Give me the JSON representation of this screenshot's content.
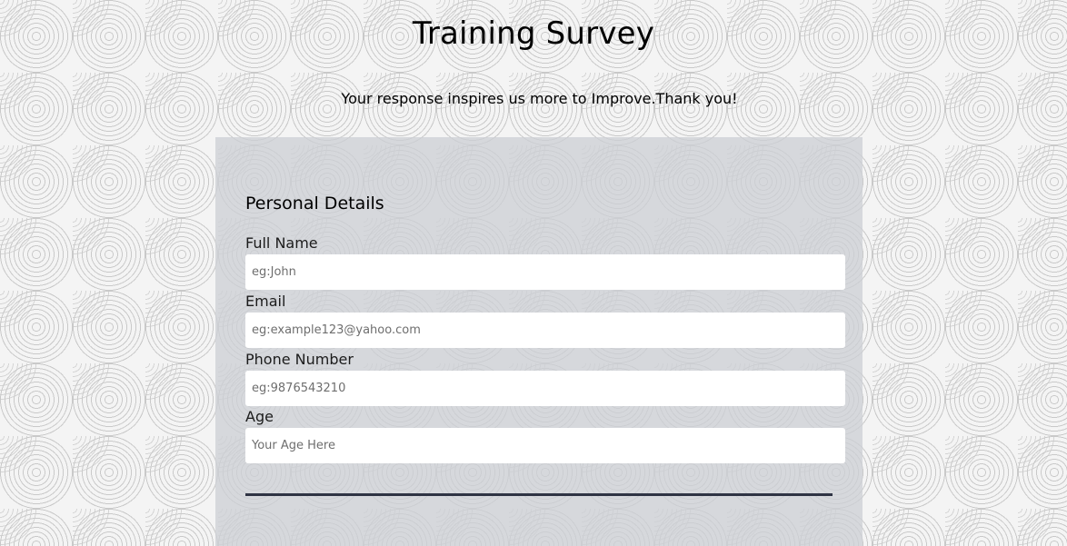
{
  "header": {
    "title": "Training Survey",
    "subtitle": "Your response inspires us more to Improve.Thank you!"
  },
  "form": {
    "section_title": "Personal Details",
    "fields": [
      {
        "label": "Full Name",
        "placeholder": "eg:John",
        "value": ""
      },
      {
        "label": "Email",
        "placeholder": "eg:example123@yahoo.com",
        "value": ""
      },
      {
        "label": "Phone Number",
        "placeholder": "eg:9876543210",
        "value": ""
      },
      {
        "label": "Age",
        "placeholder": "Your Age Here",
        "value": ""
      }
    ]
  },
  "colors": {
    "panel_background": "#cdd0d5",
    "divider": "#2f3444",
    "input_background": "#ffffff"
  }
}
